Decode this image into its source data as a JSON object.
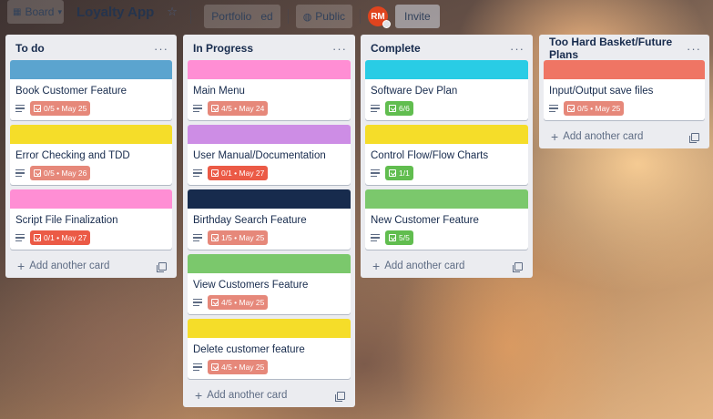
{
  "topbar": {
    "board_label": "Board",
    "board_title": "Loyalty App",
    "portfolio_label": "Portfolio",
    "portfolio_tail": "ed",
    "visibility_label": "Public",
    "avatar_initials": "RM",
    "invite_label": "Invite"
  },
  "colors": {
    "blue": "#5ba4cf",
    "yellow": "#f5dd29",
    "pink": "#ff8ed4",
    "purple": "#cd8de5",
    "navy": "#172b4d",
    "green": "#7bc86c",
    "cyan": "#29cce5",
    "orange": "#ef7564",
    "due_soon": "#e6887a",
    "overdue": "#eb5a46",
    "complete": "#61bd4f"
  },
  "add_card_label": "Add another card",
  "lists": [
    {
      "title": "To do",
      "cards": [
        {
          "title": "Book Customer Feature",
          "cover": "#5ba4cf",
          "checklist": "0/5 • May 25",
          "badge_color": "#e6887a"
        },
        {
          "title": "Error Checking and TDD",
          "cover": "#f5dd29",
          "checklist": "0/5 • May 26",
          "badge_color": "#e6887a"
        },
        {
          "title": "Script File Finalization",
          "cover": "#ff8ed4",
          "checklist": "0/1 • May 27",
          "badge_color": "#eb5a46"
        }
      ]
    },
    {
      "title": "In Progress",
      "cards": [
        {
          "title": "Main Menu",
          "cover": "#ff8ed4",
          "checklist": "4/5 • May 24",
          "badge_color": "#e6887a"
        },
        {
          "title": "User Manual/Documentation",
          "cover": "#cd8de5",
          "checklist": "0/1 • May 27",
          "badge_color": "#eb5a46"
        },
        {
          "title": "Birthday Search Feature",
          "cover": "#172b4d",
          "checklist": "1/5 • May 25",
          "badge_color": "#e6887a"
        },
        {
          "title": "View Customers Feature",
          "cover": "#7bc86c",
          "checklist": "4/5 • May 25",
          "badge_color": "#e6887a"
        },
        {
          "title": "Delete customer feature",
          "cover": "#f5dd29",
          "checklist": "4/5 • May 25",
          "badge_color": "#e6887a"
        }
      ]
    },
    {
      "title": "Complete",
      "cards": [
        {
          "title": "Software Dev Plan",
          "cover": "#29cce5",
          "checklist": "6/6",
          "badge_color": "#61bd4f"
        },
        {
          "title": "Control Flow/Flow Charts",
          "cover": "#f5dd29",
          "checklist": "1/1",
          "badge_color": "#61bd4f"
        },
        {
          "title": "New Customer Feature",
          "cover": "#7bc86c",
          "checklist": "5/5",
          "badge_color": "#61bd4f"
        }
      ]
    },
    {
      "title": "Too Hard Basket/Future Plans",
      "cards": [
        {
          "title": "Input/Output save files",
          "cover": "#ef7564",
          "checklist": "0/5 • May 25",
          "badge_color": "#e6887a"
        }
      ]
    }
  ]
}
